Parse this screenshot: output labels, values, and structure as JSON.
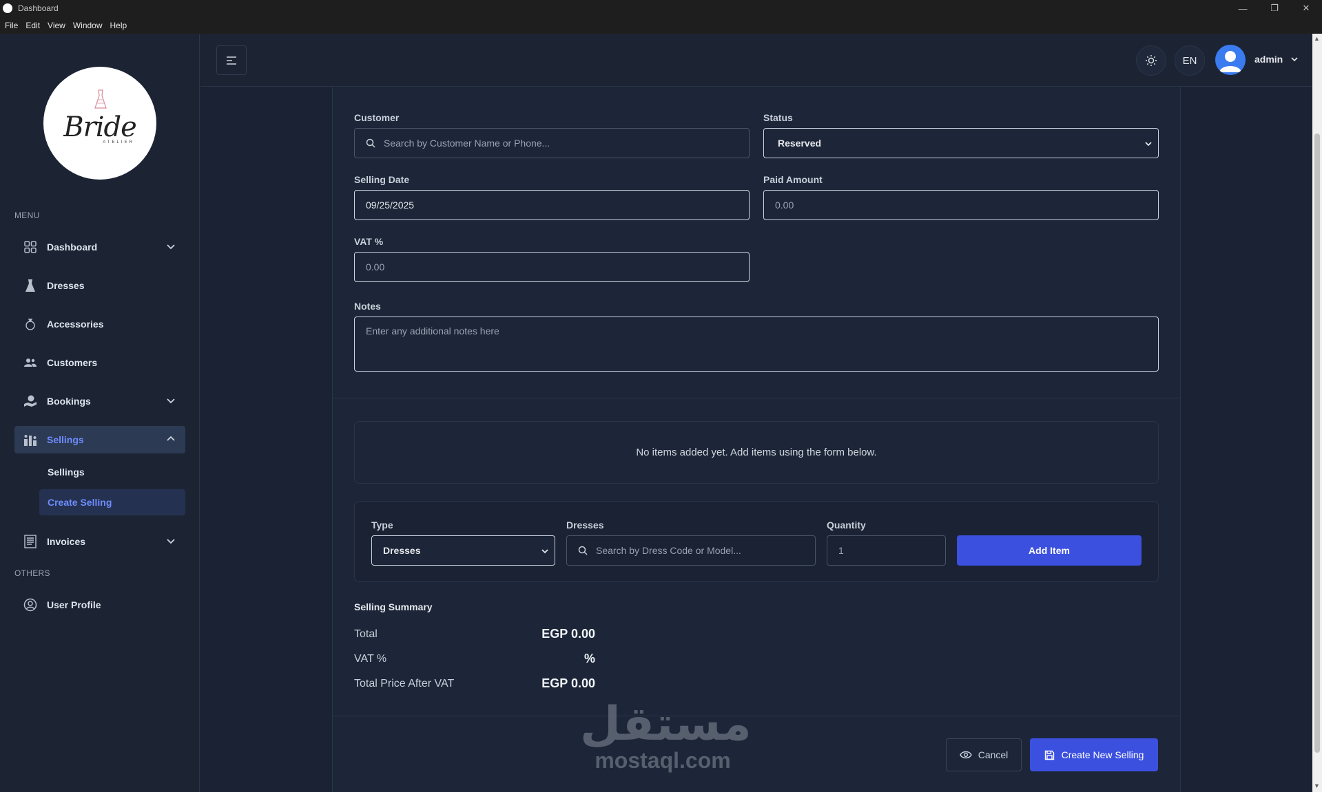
{
  "window": {
    "title": "Dashboard",
    "controls": {
      "minimize": "—",
      "restore": "❐",
      "close": "✕"
    }
  },
  "menubar": [
    "File",
    "Edit",
    "View",
    "Window",
    "Help"
  ],
  "logo": {
    "text": "Bride",
    "sub": "ATELIER"
  },
  "sidebar": {
    "menu_label": "MENU",
    "items": [
      {
        "label": "Dashboard",
        "icon": "grid-icon",
        "expandable": true
      },
      {
        "label": "Dresses",
        "icon": "dress-icon"
      },
      {
        "label": "Accessories",
        "icon": "ring-icon"
      },
      {
        "label": "Customers",
        "icon": "users-icon"
      },
      {
        "label": "Bookings",
        "icon": "booking-icon",
        "expandable": true
      },
      {
        "label": "Sellings",
        "icon": "sellings-icon",
        "expandable": true,
        "active": true
      },
      {
        "label": "Invoices",
        "icon": "invoice-icon",
        "expandable": true
      }
    ],
    "sub_items": [
      {
        "label": "Sellings"
      },
      {
        "label": "Create Selling",
        "active": true
      }
    ],
    "others_label": "OTHERS",
    "others": [
      {
        "label": "User Profile",
        "icon": "user-circle-icon"
      }
    ]
  },
  "header": {
    "lang": "EN",
    "user": "admin"
  },
  "form": {
    "customer": {
      "label": "Customer",
      "placeholder": "Search by Customer Name or Phone..."
    },
    "status": {
      "label": "Status",
      "value": "Reserved"
    },
    "selling_date": {
      "label": "Selling Date",
      "value": "09/25/2025"
    },
    "paid_amount": {
      "label": "Paid Amount",
      "placeholder": "0.00"
    },
    "vat": {
      "label": "VAT %",
      "placeholder": "0.00"
    },
    "notes": {
      "label": "Notes",
      "placeholder": "Enter any additional notes here"
    }
  },
  "items": {
    "empty_message": "No items added yet. Add items using the form below.",
    "type": {
      "label": "Type",
      "value": "Dresses"
    },
    "dresses": {
      "label": "Dresses",
      "placeholder": "Search by Dress Code or Model..."
    },
    "quantity": {
      "label": "Quantity",
      "value": "1"
    },
    "add_button": "Add Item"
  },
  "summary": {
    "title": "Selling Summary",
    "rows": [
      {
        "label": "Total",
        "value": "EGP 0.00"
      },
      {
        "label": "VAT %",
        "value": "%"
      },
      {
        "label": "Total Price After VAT",
        "value": "EGP 0.00"
      }
    ]
  },
  "actions": {
    "cancel": "Cancel",
    "create": "Create New Selling"
  },
  "watermark": {
    "arabic": "مستقل",
    "latin": "mostaql.com"
  },
  "colors": {
    "primary": "#3c50e0",
    "accent_text": "#6d8cff",
    "bg": "#1a2234"
  }
}
